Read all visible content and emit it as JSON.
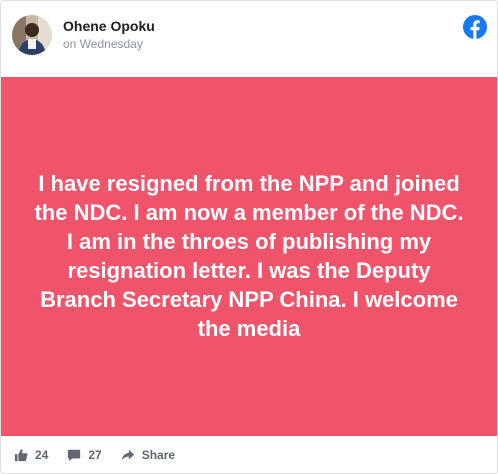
{
  "post": {
    "author": "Ohene Opoku",
    "timestamp": "on Wednesday",
    "text": "I have resigned from the NPP and joined the NDC. I am now a member of the NDC. I am in the throes of publishing my resignation letter. I was the Deputy Branch Secretary NPP China. I welcome the media",
    "background_color": "#f0546a"
  },
  "footer": {
    "likes": "24",
    "comments": "27",
    "share_label": "Share"
  },
  "icons": {
    "brand": "facebook-icon",
    "like": "thumbs-up-icon",
    "comment": "comment-icon",
    "share": "share-arrow-icon"
  },
  "colors": {
    "facebook_blue": "#1877f2",
    "footer_text": "#606770",
    "timestamp_text": "#8d949e"
  }
}
